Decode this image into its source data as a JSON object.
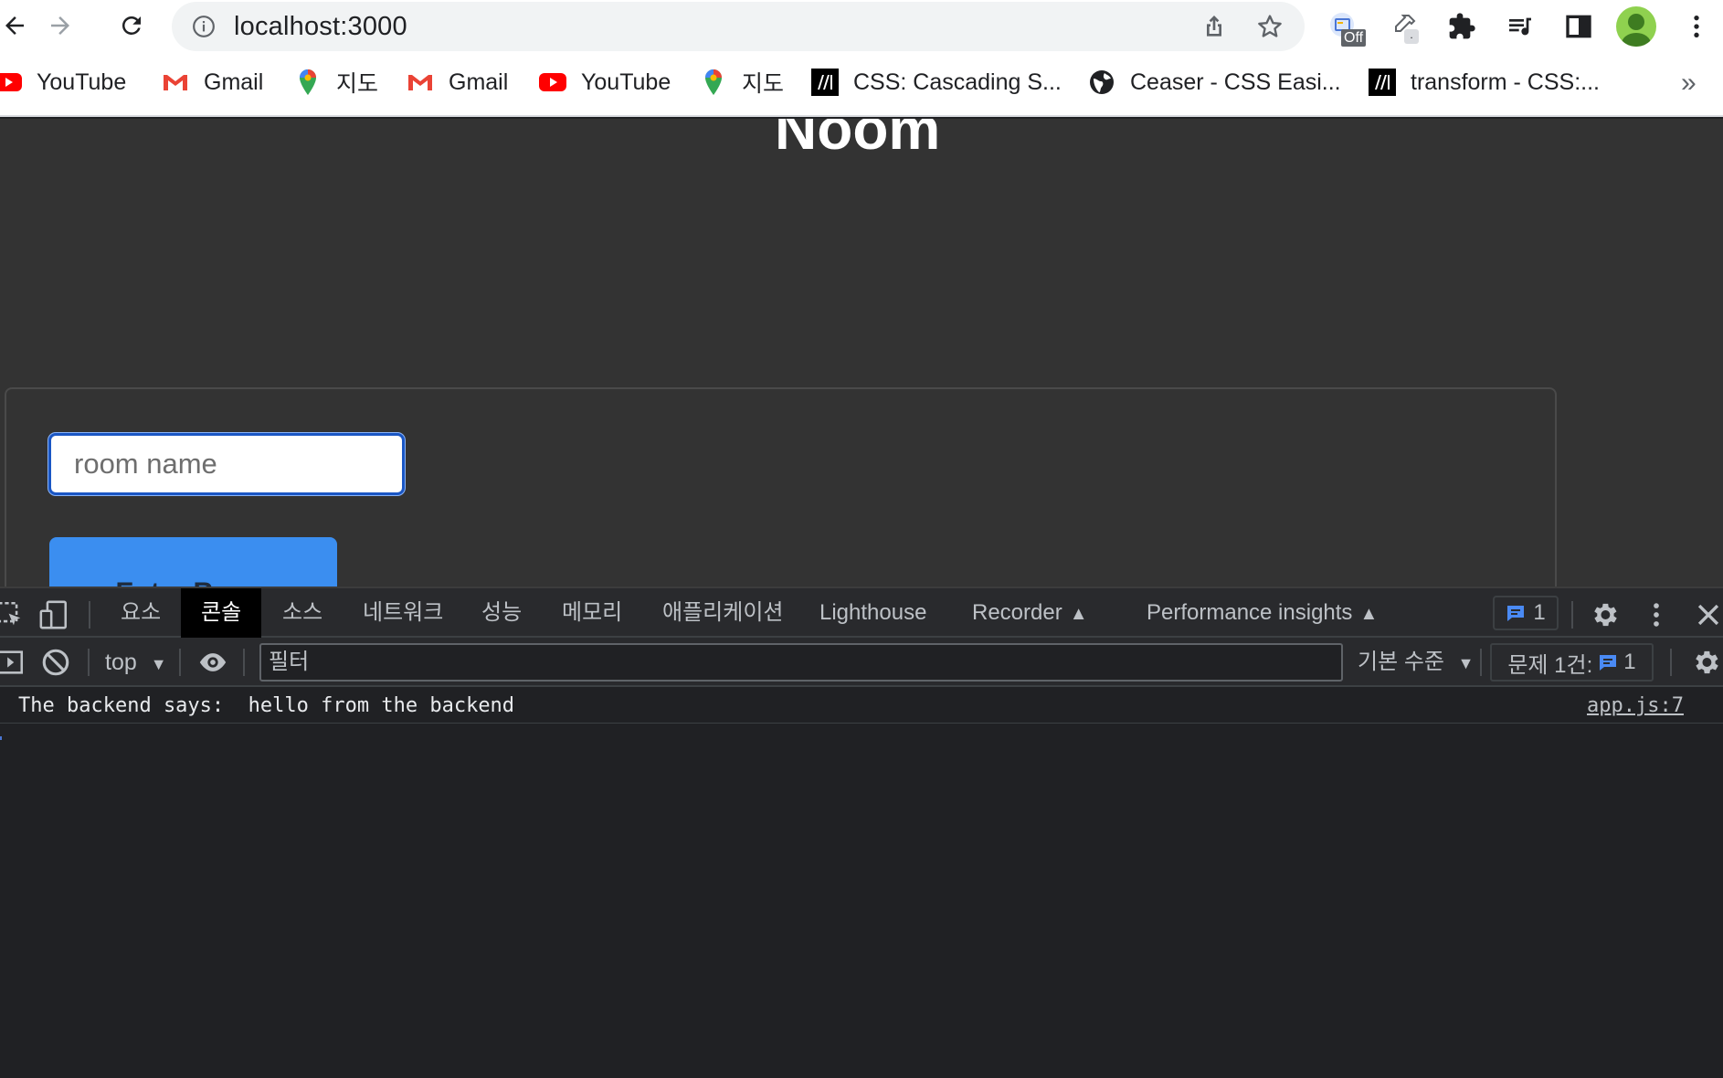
{
  "browser": {
    "url_display": "localhost:3000",
    "extensions": {
      "first_badge": "Off",
      "second_badge": "."
    }
  },
  "bookmarks": [
    {
      "label": "YouTube",
      "icon": "youtube-icon"
    },
    {
      "label": "Gmail",
      "icon": "gmail-icon"
    },
    {
      "label": "지도",
      "icon": "maps-icon"
    },
    {
      "label": "Gmail",
      "icon": "gmail-icon"
    },
    {
      "label": "YouTube",
      "icon": "youtube-icon"
    },
    {
      "label": "지도",
      "icon": "maps-icon"
    },
    {
      "label": "CSS: Cascading S...",
      "icon": "mdn-icon"
    },
    {
      "label": "Ceaser - CSS Easi...",
      "icon": "globe-icon"
    },
    {
      "label": "transform - CSS:...",
      "icon": "mdn-icon"
    }
  ],
  "bookmarks_more": "»",
  "page": {
    "title": "Noom",
    "room_input_placeholder": "room name",
    "enter_button_label": "Enter Room"
  },
  "devtools": {
    "tabs": [
      "요소",
      "콘솔",
      "소스",
      "네트워크",
      "성능",
      "메모리",
      "애플리케이션",
      "Lighthouse",
      "Recorder",
      "Performance insights"
    ],
    "active_tab": "콘솔",
    "issue_count": "1",
    "context": "top",
    "filter_placeholder": "필터",
    "levels": "기본 수준",
    "issues_label": "문제 1건:",
    "issues_count": "1",
    "console": [
      {
        "message": "The backend says:  hello from the backend",
        "source": "app.js:7"
      }
    ]
  },
  "colors": {
    "page_background": "#333333",
    "devtools_background": "#202124",
    "button_blue": "#3b8ef0",
    "input_focus_border": "#1a56c4"
  }
}
